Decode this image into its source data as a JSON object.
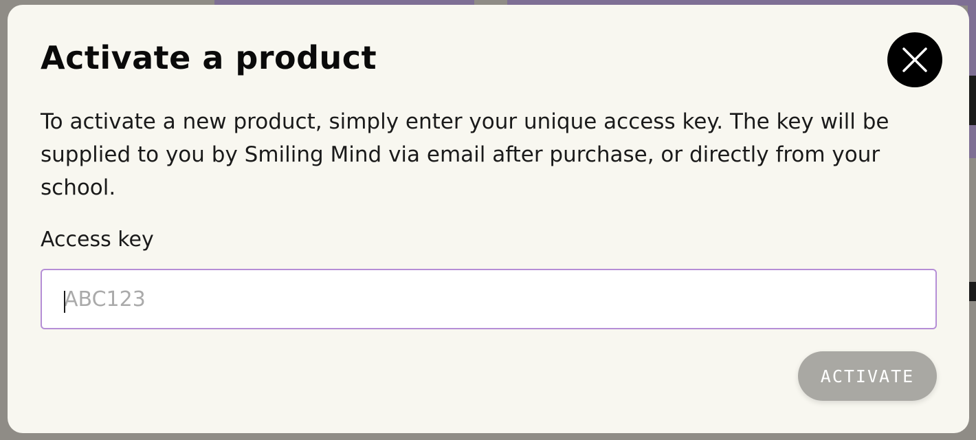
{
  "modal": {
    "title": "Activate a product",
    "description": "To activate a new product, simply enter your unique access key. The key will be supplied to you by Smiling Mind via email after purchase, or directly from your school.",
    "field_label": "Access key",
    "input_value": "",
    "input_placeholder": "ABC123",
    "activate_label": "ACTIVATE",
    "close_icon": "close-icon"
  },
  "colors": {
    "modal_bg": "#f8f7f0",
    "input_border": "#b58ed6",
    "button_disabled": "#a9a8a3",
    "backdrop_accent": "#7e6f94"
  }
}
